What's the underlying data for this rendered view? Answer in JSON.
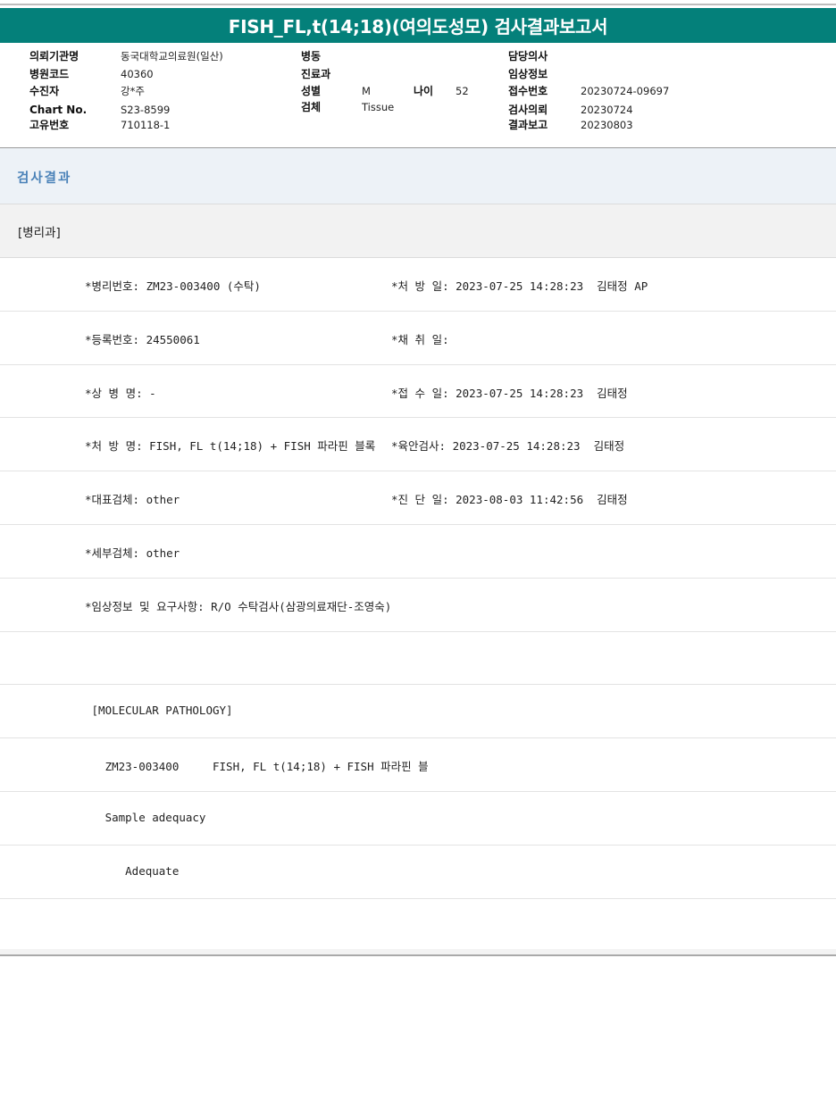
{
  "title": "FISH_FL,t(14;18)(여의도성모) 검사결과보고서",
  "patient_info": {
    "col1": [
      {
        "label": "의뢰기관명",
        "value": "동국대학교의료원(일산)"
      },
      {
        "label": "병원코드",
        "value": "40360"
      },
      {
        "label": "수진자",
        "value": "강*주"
      },
      {
        "label": "Chart No.",
        "value": "S23-8599"
      },
      {
        "label": "고유번호",
        "value": "710118-1"
      }
    ],
    "col2": [
      {
        "label": "병동",
        "value": ""
      },
      {
        "label": "진료과",
        "value": ""
      },
      {
        "label": "성별",
        "value": "M"
      },
      {
        "label": "검체",
        "value": "Tissue"
      }
    ],
    "age": {
      "label": "나이",
      "value": "52"
    },
    "col3": [
      {
        "label": "담당의사",
        "value": ""
      },
      {
        "label": "임상정보",
        "value": ""
      },
      {
        "label": "접수번호",
        "value": "20230724-09697"
      },
      {
        "label": "검사의뢰",
        "value": "20230724"
      },
      {
        "label": "결과보고",
        "value": "20230803"
      }
    ]
  },
  "section_title": "검사결과",
  "department": "[병리과]",
  "result_rows": [
    {
      "left": "*병리번호: ZM23-003400 (수탁)",
      "right": "*처 방 일: 2023-07-25 14:28:23  김태정 AP"
    },
    {
      "left": "*등록번호: 24550061",
      "right": "*채 취 일:"
    },
    {
      "left": "*상 병 명: -",
      "right": "*접 수 일: 2023-07-25 14:28:23  김태정"
    },
    {
      "left": "*처 방 명: FISH, FL t(14;18) + FISH 파라핀 블록",
      "right": "*육안검사: 2023-07-25 14:28:23  김태정"
    },
    {
      "left": "*대표검체: other",
      "right": "*진 단 일: 2023-08-03 11:42:56  김태정"
    },
    {
      "left": "*세부검체: other",
      "right": ""
    },
    {
      "left": "*임상정보 및 요구사항: R/O 수탁검사(삼광의료재단-조영숙)",
      "right": ""
    },
    {
      "left": "",
      "right": ""
    },
    {
      "left": " [MOLECULAR PATHOLOGY]",
      "right": ""
    },
    {
      "left": "   ZM23-003400     FISH, FL t(14;18) + FISH 파라핀 블",
      "right": ""
    },
    {
      "left": "   Sample adequacy",
      "right": ""
    },
    {
      "left": "      Adequate",
      "right": ""
    },
    {
      "left": "",
      "right": ""
    }
  ],
  "colors": {
    "title_bg": "#04807a",
    "section_text": "#4a82b8",
    "section_bg": "#edf2f7"
  }
}
